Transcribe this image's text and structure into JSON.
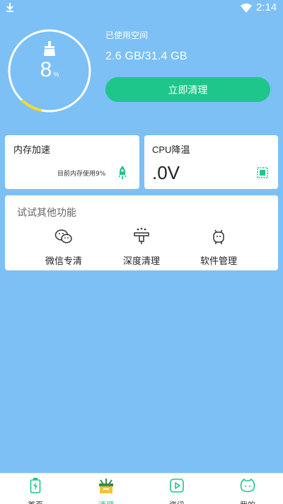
{
  "status_bar": {
    "time": "2:14"
  },
  "gauge": {
    "value": "8",
    "unit": "%",
    "used_fraction": 0.08
  },
  "storage": {
    "label": "已使用空间",
    "value": "2.6 GB/31.4 GB"
  },
  "clean_button": {
    "label": "立即清理"
  },
  "memory_card": {
    "title": "内存加速",
    "subtitle": "目前内存使用9%"
  },
  "cpu_card": {
    "title": "CPU降温",
    "value": ".0V"
  },
  "features": {
    "title": "试试其他功能",
    "items": [
      {
        "label": "微信专清",
        "icon": "wechat-icon"
      },
      {
        "label": "深度清理",
        "icon": "deep-clean-icon"
      },
      {
        "label": "软件管理",
        "icon": "app-manage-icon"
      }
    ]
  },
  "bottom_nav": {
    "items": [
      {
        "label": "首页",
        "icon": "battery-icon"
      },
      {
        "label": "清理",
        "icon": "broom-box-icon",
        "active": true
      },
      {
        "label": "资讯",
        "icon": "play-icon"
      },
      {
        "label": "我的",
        "icon": "face-icon"
      }
    ]
  },
  "colors": {
    "background": "#7cc0f6",
    "accent": "#1fc68b",
    "gauge_fill": "#f5d838"
  }
}
